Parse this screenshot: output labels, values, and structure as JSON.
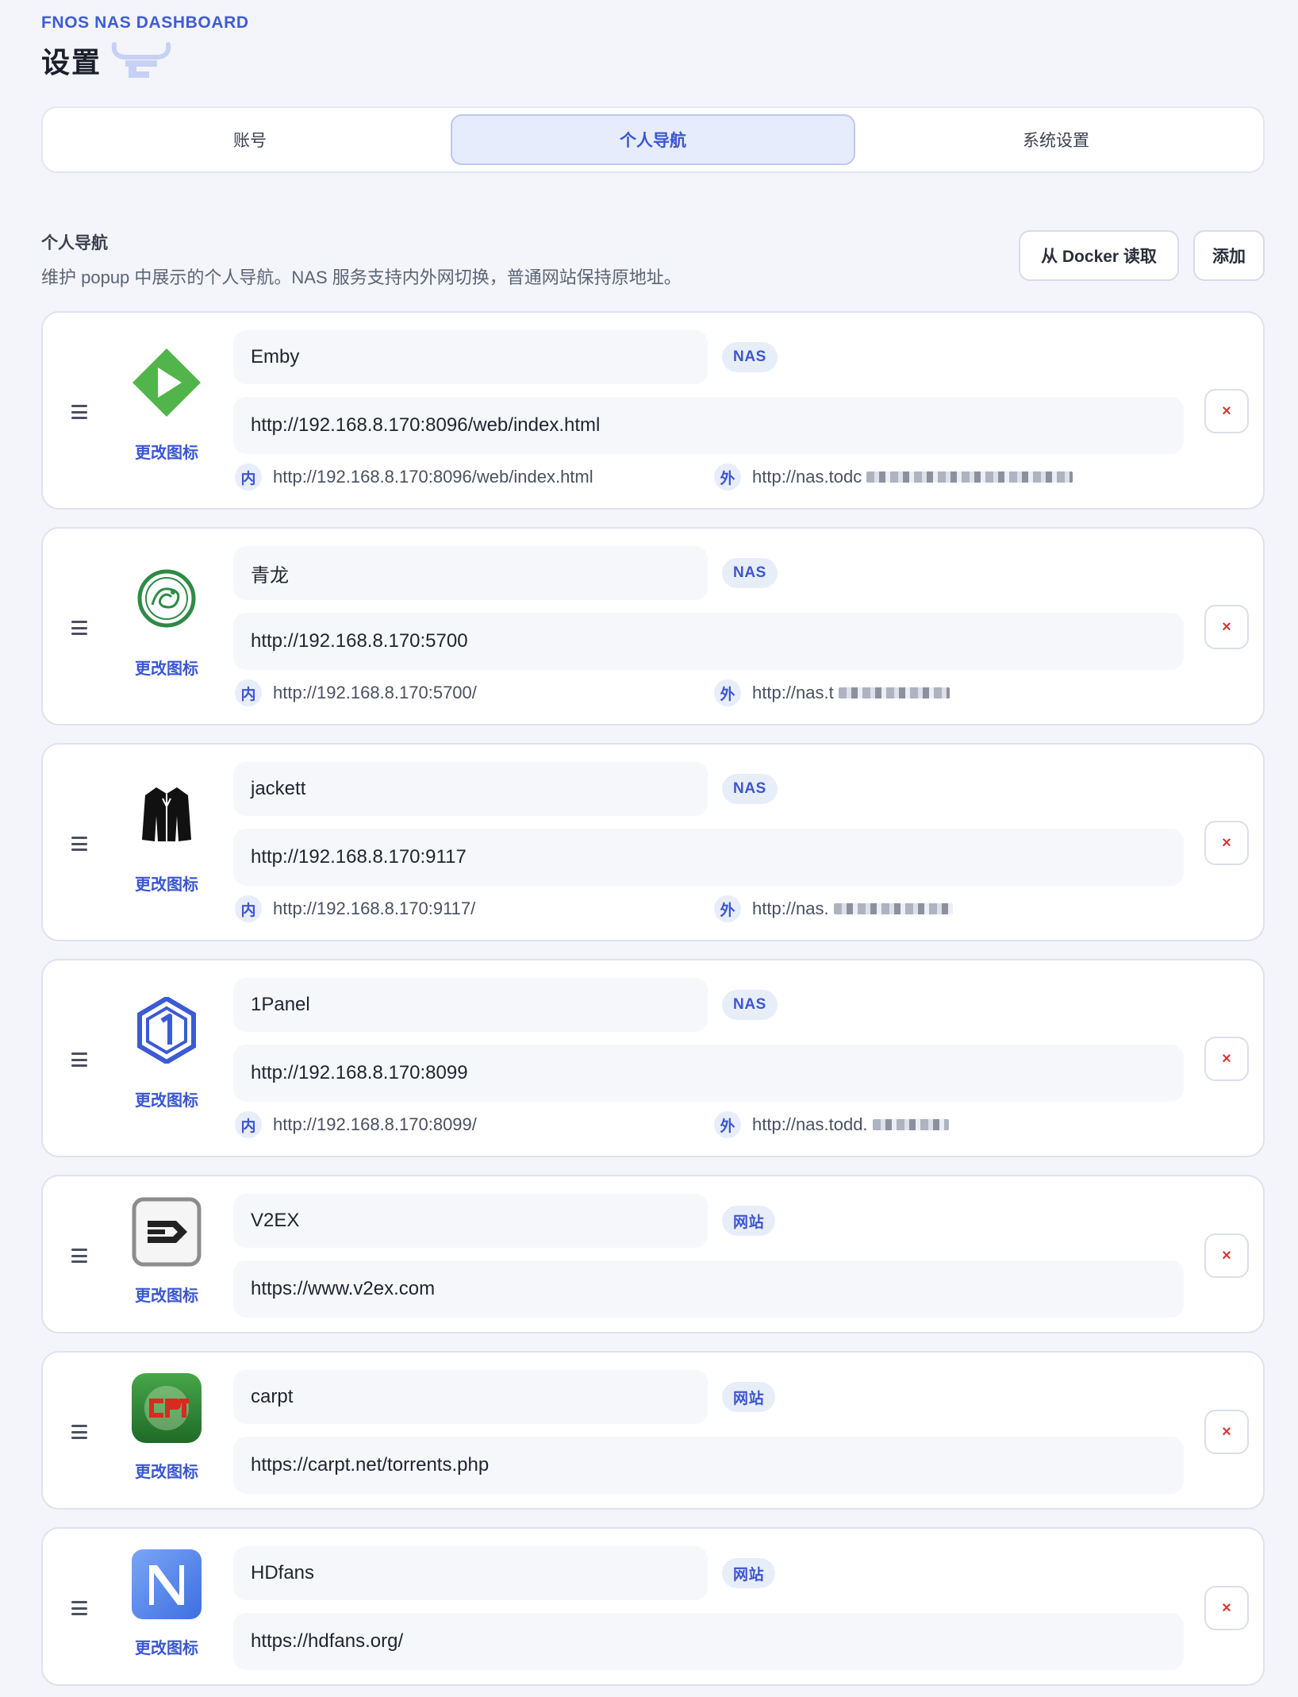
{
  "header": {
    "brand": "FNOS NAS DASHBOARD",
    "title": "设置"
  },
  "tabs": [
    {
      "label": "账号",
      "active": false
    },
    {
      "label": "个人导航",
      "active": true
    },
    {
      "label": "系统设置",
      "active": false
    }
  ],
  "section": {
    "title": "个人导航",
    "description": "维护 popup 中展示的个人导航。NAS 服务支持内外网切换，普通网站保持原地址。",
    "docker_button": "从 Docker 读取",
    "add_button": "添加"
  },
  "labels": {
    "change_icon": "更改图标",
    "inner_tag": "内",
    "outer_tag": "外",
    "delete": "×"
  },
  "items": [
    {
      "name": "Emby",
      "type": "NAS",
      "url": "http://192.168.8.170:8096/web/index.html",
      "inner": "http://192.168.8.170:8096/web/index.html",
      "outer": "http://nas.todc",
      "icon": "emby-icon"
    },
    {
      "name": "青龙",
      "type": "NAS",
      "url": "http://192.168.8.170:5700",
      "inner": "http://192.168.8.170:5700/",
      "outer": "http://nas.t",
      "icon": "qinglong-icon"
    },
    {
      "name": "jackett",
      "type": "NAS",
      "url": "http://192.168.8.170:9117",
      "inner": "http://192.168.8.170:9117/",
      "outer": "http://nas.",
      "icon": "jackett-icon"
    },
    {
      "name": "1Panel",
      "type": "NAS",
      "url": "http://192.168.8.170:8099",
      "inner": "http://192.168.8.170:8099/",
      "outer": "http://nas.todd.",
      "icon": "1panel-icon"
    },
    {
      "name": "V2EX",
      "type": "网站",
      "url": "https://www.v2ex.com",
      "icon": "v2ex-icon"
    },
    {
      "name": "carpt",
      "type": "网站",
      "url": "https://carpt.net/torrents.php",
      "icon": "carpt-icon"
    },
    {
      "name": "HDfans",
      "type": "网站",
      "url": "https://hdfans.org/",
      "icon": "hdfans-icon"
    }
  ],
  "colors": {
    "accent": "#3b56d1",
    "background": "#f3f5fa",
    "danger": "#d23a3a"
  }
}
